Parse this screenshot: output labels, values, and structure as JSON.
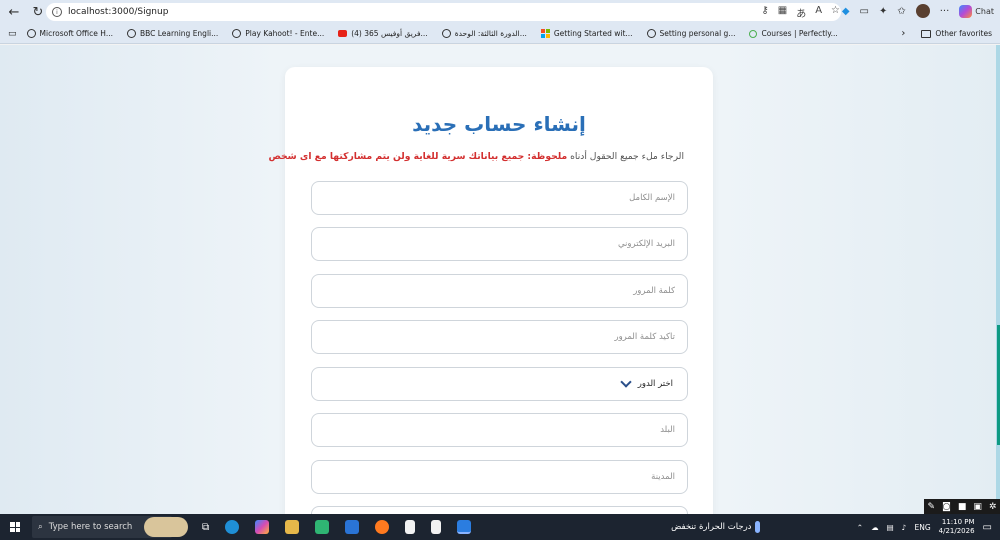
{
  "browser": {
    "url": "localhost:3000/Signup",
    "chat_label": "Chat"
  },
  "bookmarks": [
    {
      "label": "Microsoft Office H...",
      "icon": "globe-icon"
    },
    {
      "label": "BBC Learning Engli...",
      "icon": "globe-icon"
    },
    {
      "label": "Play Kahoot! - Ente...",
      "icon": "globe-icon"
    },
    {
      "label": "(4) فريق أوفيس 365...",
      "icon": "youtube-icon"
    },
    {
      "label": "الدورة الثالثة: الوحدة...",
      "icon": "globe-icon"
    },
    {
      "label": "Getting Started wit...",
      "icon": "microsoft-icon"
    },
    {
      "label": "Setting personal g...",
      "icon": "globe-icon"
    },
    {
      "label": "Courses | Perfectly...",
      "icon": "ring-icon"
    }
  ],
  "other_favorites": "Other favorites",
  "form": {
    "title": "إنشاء حساب جديد",
    "note_plain": "الرجاء ملء جميع الحقول أدناه",
    "note_bold": "ملحوظة: جميع بياناتك سرية للغاية ولن يتم مشاركتها مع اى شخص",
    "fields": {
      "fullname": "الإسم الكامل",
      "email": "البريد الإلكتروني",
      "password": "كلمة المرور",
      "confirm": "تأكيد كلمة المرور",
      "role": "اختر الدور",
      "country": "البلد",
      "city": "المدينة"
    }
  },
  "taskbar": {
    "search_placeholder": "Type here to search",
    "weather_text": "درجات الحرارة تنخفض",
    "lang": "ENG",
    "time": "11:10 PM",
    "date": "4/21/2026"
  },
  "colors": {
    "title": "#2a6fb7",
    "note_bold": "#d32f2f",
    "page_background": "#eef4f8",
    "taskbar": "#1c2430"
  }
}
